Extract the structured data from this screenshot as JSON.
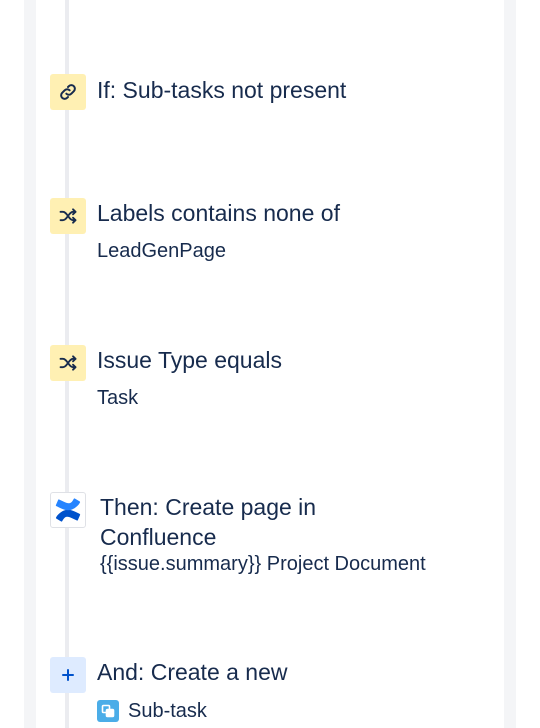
{
  "components": {
    "condition_subtasks": {
      "title": "If: Sub-tasks not present",
      "icon": "link-icon",
      "icon_bg": "#fff0b3"
    },
    "condition_labels": {
      "title": "Labels contains none of",
      "value": "LeadGenPage",
      "icon": "shuffle-icon",
      "icon_bg": "#fff0b3"
    },
    "condition_issue_type": {
      "title": "Issue Type equals",
      "value": "Task",
      "icon": "shuffle-icon",
      "icon_bg": "#fff0b3"
    },
    "action_confluence": {
      "title_line1": "Then: Create page in",
      "title_line2": "Confluence",
      "value": "{{issue.summary}} Project Document",
      "icon": "confluence-icon",
      "icon_color": "#0052cc"
    },
    "action_create": {
      "title": "And: Create a new",
      "value": "Sub-task",
      "icon": "plus-icon",
      "icon_bg": "#deebff",
      "value_icon": "subtask-icon",
      "value_icon_color": "#4bade8"
    }
  }
}
